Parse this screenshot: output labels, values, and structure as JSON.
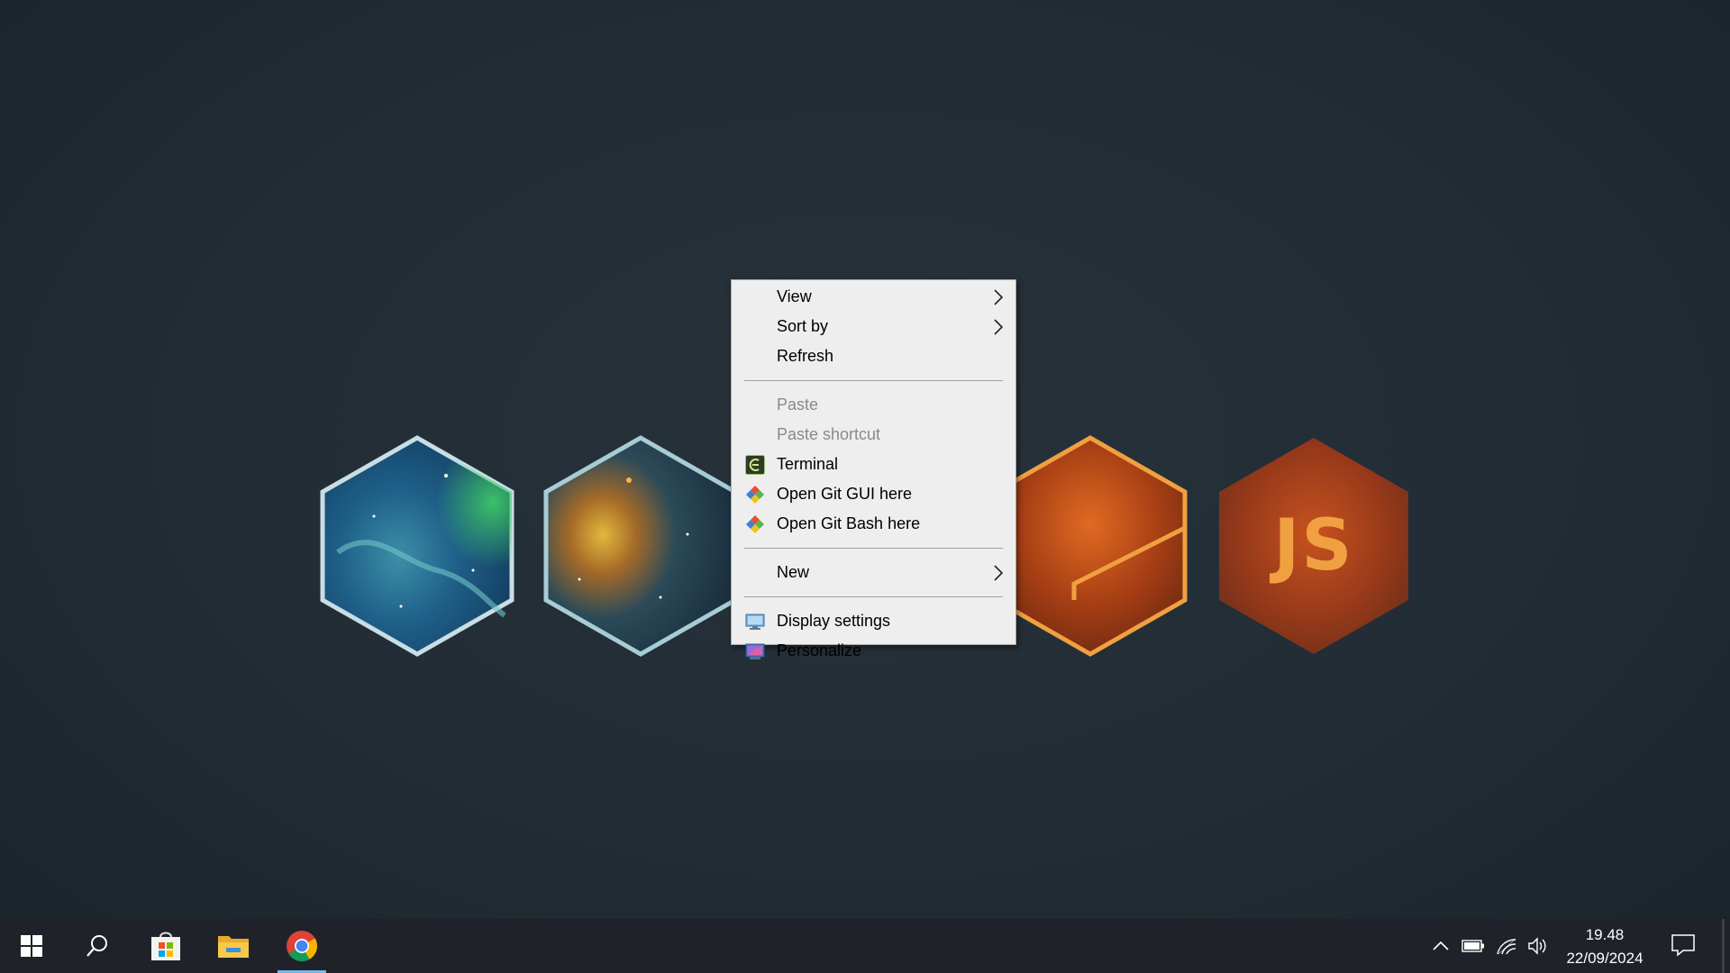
{
  "context_menu": {
    "items": [
      {
        "label": "View",
        "has_submenu": true
      },
      {
        "label": "Sort by",
        "has_submenu": true
      },
      {
        "label": "Refresh"
      },
      {
        "label": "Paste",
        "disabled": true
      },
      {
        "label": "Paste shortcut",
        "disabled": true
      },
      {
        "label": "Terminal",
        "icon": "terminal-icon"
      },
      {
        "label": "Open Git GUI here",
        "icon": "git-icon"
      },
      {
        "label": "Open Git Bash here",
        "icon": "git-icon"
      },
      {
        "label": "New",
        "has_submenu": true
      },
      {
        "label": "Display settings",
        "icon": "display-settings-icon"
      },
      {
        "label": "Personalize",
        "icon": "personalize-icon"
      }
    ]
  },
  "wallpaper": {
    "hexagons": [
      {
        "style": "blue-nebula",
        "label": ""
      },
      {
        "style": "teal-nebula",
        "label": ""
      },
      {
        "style": "orange-nebula",
        "label": ""
      },
      {
        "style": "orange-js",
        "label": "JS"
      }
    ]
  },
  "taskbar": {
    "apps": [
      {
        "name": "start-icon"
      },
      {
        "name": "search-icon"
      },
      {
        "name": "microsoft-store-icon"
      },
      {
        "name": "file-explorer-icon"
      },
      {
        "name": "chrome-icon",
        "active": true
      }
    ],
    "tray": [
      "chevron-up-icon",
      "battery-icon",
      "wifi-icon",
      "volume-icon"
    ],
    "clock": {
      "time": "19.48",
      "date": "22/09/2024"
    }
  },
  "colors": {
    "menu_bg": "#eeeeee",
    "taskbar_bg": "#1f2329",
    "active_indicator": "#76b9ed",
    "desktop_bg": "#222c34"
  }
}
